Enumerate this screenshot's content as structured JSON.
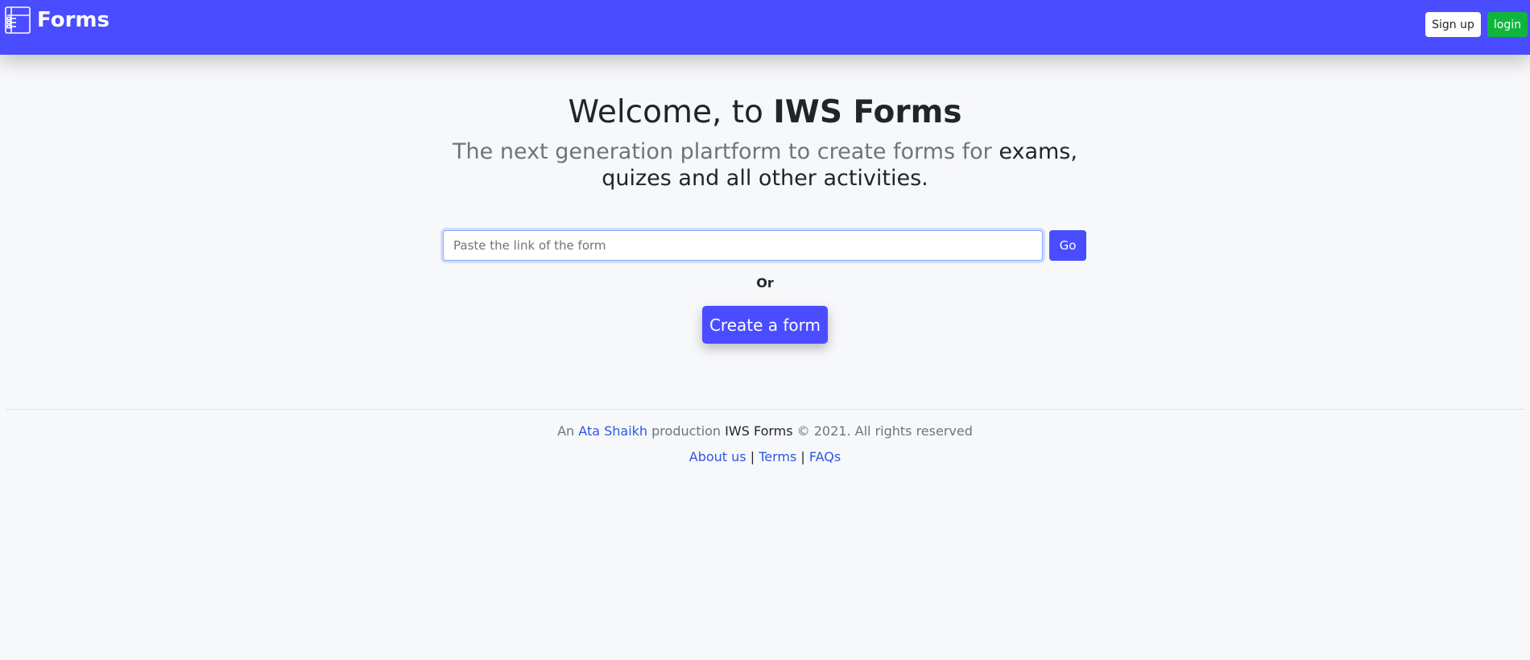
{
  "navbar": {
    "brand": "Forms",
    "brand_icon": "form-list-icon",
    "signup_label": "Sign up",
    "login_label": "login",
    "colors": {
      "background": "#4a4dff",
      "login": "#10b53e"
    }
  },
  "hero": {
    "title_prefix": "Welcome, to ",
    "title_bold": "IWS Forms",
    "subtitle_muted": "The next generation plartform to create forms for ",
    "subtitle_dark": "exams, quizes and all other activities."
  },
  "search": {
    "placeholder": "Paste the link of the form",
    "value": "",
    "go_label": "Go"
  },
  "or_label": "Or",
  "create_label": "Create a form",
  "footer": {
    "prefix": "An ",
    "author": "Ata Shaikh",
    "middle": " production ",
    "product": "IWS Forms",
    "suffix": " © 2021. All rights reserved",
    "links": [
      "About us",
      "Terms",
      "FAQs"
    ],
    "separator": " | "
  }
}
